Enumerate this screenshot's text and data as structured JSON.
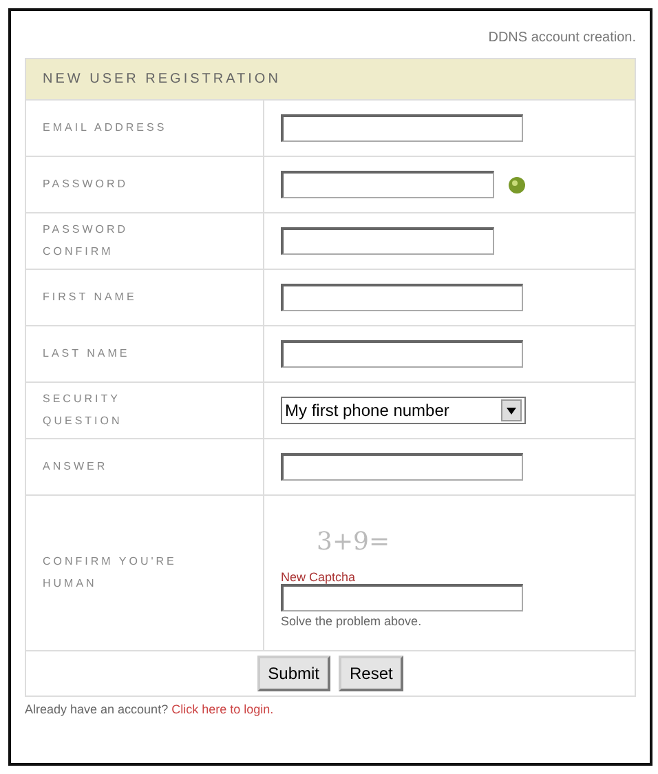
{
  "top_note": "DDNS account creation.",
  "form": {
    "title": "NEW USER REGISTRATION",
    "rows": [
      {
        "kind": "text",
        "label": "EMAIL ADDRESS"
      },
      {
        "kind": "password",
        "label": "PASSWORD",
        "hint_icon": true
      },
      {
        "kind": "password",
        "label": "PASSWORD CONFIRM",
        "hint_icon": false
      },
      {
        "kind": "text",
        "label": "FIRST NAME"
      },
      {
        "kind": "text",
        "label": "LAST NAME"
      },
      {
        "kind": "select",
        "label": "SECURITY QUESTION",
        "value": "My first phone number"
      },
      {
        "kind": "text",
        "label": "ANSWER"
      },
      {
        "kind": "captcha",
        "label": "CONFIRM YOU'RE HUMAN",
        "problem": "3+9=",
        "new_link": "New Captcha",
        "help": "Solve the problem above."
      }
    ],
    "buttons": [
      "Submit",
      "Reset"
    ]
  },
  "footer": {
    "text": "Already have an account?",
    "link": "Click here to login."
  }
}
